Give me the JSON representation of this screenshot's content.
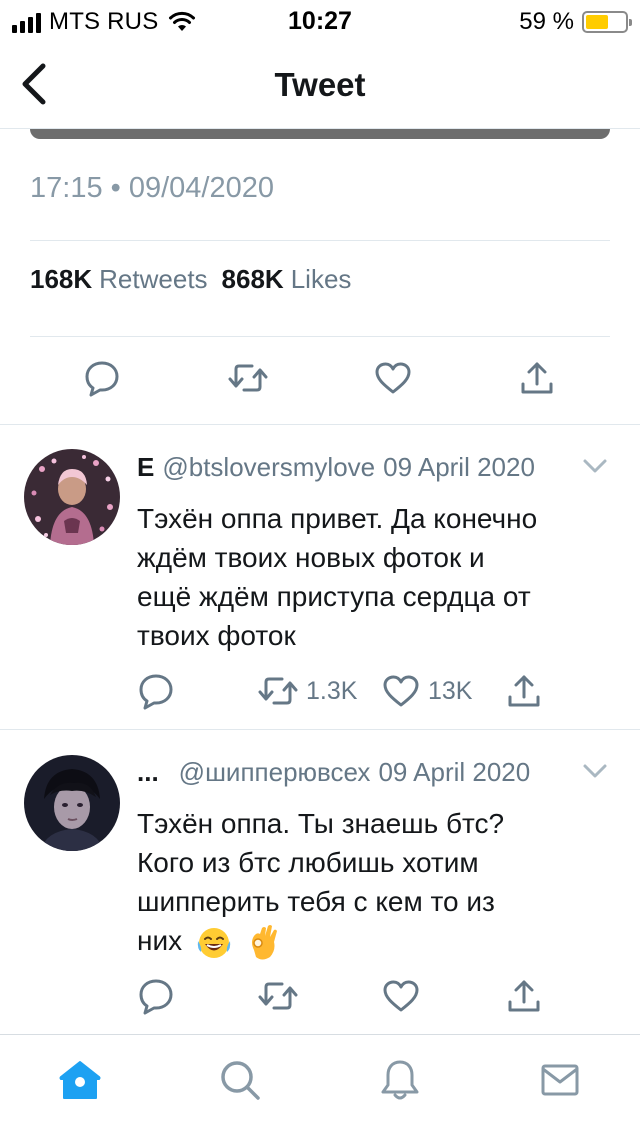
{
  "status_bar": {
    "carrier": "MTS RUS",
    "time": "10:27",
    "battery_percent": "59 %",
    "battery_level": 0.59,
    "battery_color": "#ffcc00"
  },
  "header": {
    "title": "Tweet"
  },
  "tweet": {
    "timestamp": "17:15 • 09/04/2020",
    "retweets_count": "168K",
    "retweets_label": "Retweets",
    "likes_count": "868K",
    "likes_label": "Likes"
  },
  "replies": [
    {
      "name": "E",
      "handle": "@btsloversmylove",
      "date": "09 April 2020",
      "text_lines": [
        "Тэхён оппа привет. Да конечно",
        "ждём твоих новых фоток и",
        "ещё ждём приступа сердца от",
        "твоих фоток"
      ],
      "retweets": "1.3K",
      "likes": "13K"
    },
    {
      "name": "...",
      "handle": "@шипперювсех",
      "date": "09 April 2020",
      "text_lines": [
        "Тэхён оппа. Ты знаешь бтс?",
        "Кого из бтс любишь хотим",
        "шипперить тебя с кем то из",
        "них"
      ],
      "emojis": [
        "face-with-tears-of-joy-icon",
        "ok-hand-icon"
      ]
    }
  ],
  "tab_bar": {
    "items": [
      "home-icon",
      "search-icon",
      "notifications-icon",
      "messages-icon"
    ],
    "active_color": "#1da1f2",
    "inactive_color": "#8899a6"
  }
}
